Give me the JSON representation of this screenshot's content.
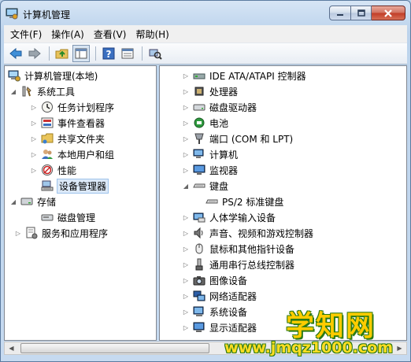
{
  "window": {
    "title": "计算机管理"
  },
  "menu": [
    "文件(F)",
    "操作(A)",
    "查看(V)",
    "帮助(H)"
  ],
  "toolbar": [
    "back-icon",
    "forward-icon",
    "up-folder-icon",
    "show-hide-tree-icon",
    "help-icon",
    "properties-icon",
    "scan-hardware-icon"
  ],
  "left_tree": {
    "root": "计算机管理(本地)",
    "system_tools": "系统工具",
    "task_scheduler": "任务计划程序",
    "event_viewer": "事件查看器",
    "shared_folders": "共享文件夹",
    "local_users": "本地用户和组",
    "performance": "性能",
    "device_manager": "设备管理器",
    "storage": "存储",
    "disk_management": "磁盘管理",
    "services_apps": "服务和应用程序"
  },
  "devices": {
    "ide": "IDE ATA/ATAPI 控制器",
    "cpu": "处理器",
    "disk": "磁盘驱动器",
    "battery": "电池",
    "ports": "端口 (COM 和 LPT)",
    "computer": "计算机",
    "monitor": "监视器",
    "keyboard": "键盘",
    "ps2_keyboard": "PS/2 标准键盘",
    "hid": "人体学输入设备",
    "audio": "声音、视频和游戏控制器",
    "mouse": "鼠标和其他指针设备",
    "usb": "通用串行总线控制器",
    "imaging": "图像设备",
    "network": "网络适配器",
    "system_devices": "系统设备",
    "display": "显示适配器"
  },
  "watermark": {
    "title": "学知网",
    "url": "www.jmqz1000.com"
  },
  "colors": {
    "selection": "#dce9f8",
    "title_bar": "#bcd3ec",
    "close_button": "#c13c26",
    "watermark": "#ffcc00"
  }
}
